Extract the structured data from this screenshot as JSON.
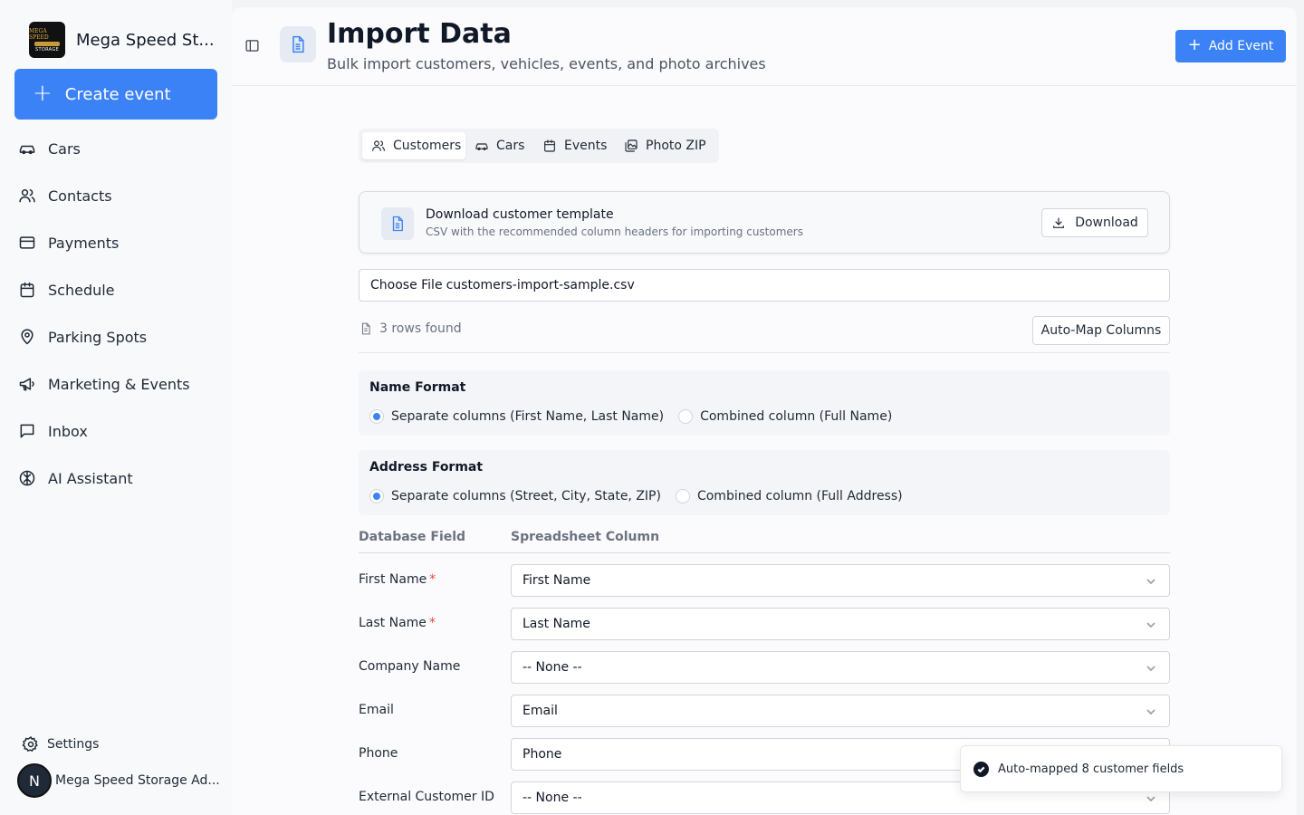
{
  "sidebar": {
    "brand_name": "Mega Speed St...",
    "logo_text_top": "MEGA SPEED",
    "logo_text_bottom": "STORAGE",
    "create_label": "Create event",
    "items": [
      {
        "label": "Cars",
        "icon": "car-icon"
      },
      {
        "label": "Contacts",
        "icon": "users-icon"
      },
      {
        "label": "Payments",
        "icon": "credit-card-icon"
      },
      {
        "label": "Schedule",
        "icon": "calendar-icon"
      },
      {
        "label": "Parking Spots",
        "icon": "map-pin-icon"
      },
      {
        "label": "Marketing & Events",
        "icon": "megaphone-icon"
      },
      {
        "label": "Inbox",
        "icon": "message-square-icon"
      },
      {
        "label": "AI Assistant",
        "icon": "brain-icon"
      }
    ],
    "settings_label": "Settings",
    "account_initial": "N",
    "account_name": "Mega Speed Storage Ad..."
  },
  "header": {
    "title": "Import Data",
    "subtitle": "Bulk import customers, vehicles, events, and photo archives",
    "add_event_label": "Add Event"
  },
  "tabs": [
    {
      "label": "Customers",
      "active": true
    },
    {
      "label": "Cars",
      "active": false
    },
    {
      "label": "Events",
      "active": false
    },
    {
      "label": "Photo ZIP",
      "active": false
    }
  ],
  "template": {
    "title": "Download customer template",
    "description": "CSV with the recommended column headers for importing customers",
    "download_label": "Download"
  },
  "file_input": {
    "button_label": "Choose File",
    "file_name": "customers-import-sample.csv"
  },
  "rows_found": "3 rows found",
  "automap_label": "Auto-Map Columns",
  "name_format": {
    "title": "Name Format",
    "option_separate": "Separate columns (First Name, Last Name)",
    "option_combined": "Combined column (Full Name)",
    "selected": "separate"
  },
  "address_format": {
    "title": "Address Format",
    "option_separate": "Separate columns (Street, City, State, ZIP)",
    "option_combined": "Combined column (Full Address)",
    "selected": "separate"
  },
  "mapping": {
    "col_database": "Database Field",
    "col_spreadsheet": "Spreadsheet Column",
    "rows": [
      {
        "field": "First Name",
        "required": true,
        "value": "First Name"
      },
      {
        "field": "Last Name",
        "required": true,
        "value": "Last Name"
      },
      {
        "field": "Company Name",
        "required": false,
        "value": "-- None --"
      },
      {
        "field": "Email",
        "required": false,
        "value": "Email"
      },
      {
        "field": "Phone",
        "required": false,
        "value": "Phone"
      },
      {
        "field": "External Customer ID",
        "required": false,
        "value": "-- None --"
      }
    ],
    "required_mark": "*"
  },
  "toast": {
    "message": "Auto-mapped 8 customer fields"
  },
  "colors": {
    "accent": "#3b82f6",
    "required": "#ef4444"
  }
}
